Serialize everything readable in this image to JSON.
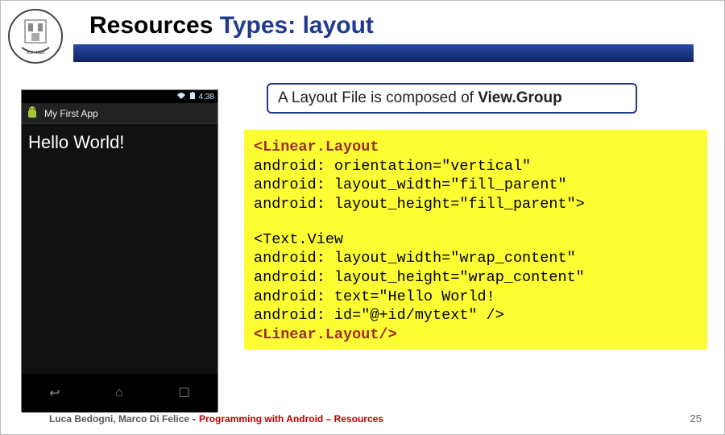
{
  "slide": {
    "title_black1": "Resources ",
    "title_blue": "Types: ",
    "title_black2": "layout",
    "number": "25"
  },
  "callout": {
    "prefix": "A Layout File is composed of ",
    "bold": "View.Group"
  },
  "phone": {
    "time": "4:38",
    "app_title": "My First App",
    "body_text": "Hello World!",
    "nav_back": "↩",
    "nav_home": "⌂",
    "nav_recent": "☐"
  },
  "code": {
    "l1_kw": "<Linear.Layout",
    "l2": " android: orientation=\"vertical\"",
    "l3": " android: layout_width=\"fill_parent\"",
    "l4": " android: layout_height=\"fill_parent\">",
    "l5": "<Text.View",
    "l6": "   android: layout_width=\"wrap_content\"",
    "l7": "   android: layout_height=\"wrap_content\"",
    "l8": "   android: text=\"Hello World!",
    "l9": "   android: id=\"@+id/mytext\" />",
    "l10_kw": "<Linear.Layout/>"
  },
  "footer": {
    "authors": "Luca Bedogni, Marco Di Felice",
    "sep": "-",
    "course": "Programming with Android – Resources"
  }
}
